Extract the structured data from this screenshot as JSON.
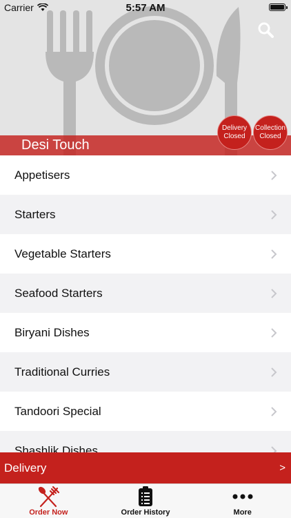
{
  "status_bar": {
    "carrier": "Carrier",
    "time": "5:57 AM"
  },
  "header": {
    "restaurant_name": "Desi Touch",
    "delivery_badge": {
      "line1": "Delivery",
      "line2": "Closed"
    },
    "collection_badge": {
      "line1": "Collection",
      "line2": "Closed"
    }
  },
  "menu": {
    "items": [
      {
        "label": "Appetisers"
      },
      {
        "label": "Starters"
      },
      {
        "label": "Vegetable Starters"
      },
      {
        "label": "Seafood Starters"
      },
      {
        "label": "Biryani Dishes"
      },
      {
        "label": "Traditional Curries"
      },
      {
        "label": "Tandoori Special"
      },
      {
        "label": "Shashlik Dishes"
      }
    ]
  },
  "delivery_bar": {
    "label": "Delivery",
    "arrow": ">"
  },
  "tab_bar": {
    "tabs": [
      {
        "label": "Order Now",
        "icon": "fork-knife-icon",
        "active": true
      },
      {
        "label": "Order History",
        "icon": "clipboard-list-icon",
        "active": false
      },
      {
        "label": "More",
        "icon": "more-dots-icon",
        "active": false
      }
    ]
  },
  "colors": {
    "accent": "#c4211d",
    "header_bg": "#e4e4e4",
    "alt_row": "#f2f2f4"
  }
}
